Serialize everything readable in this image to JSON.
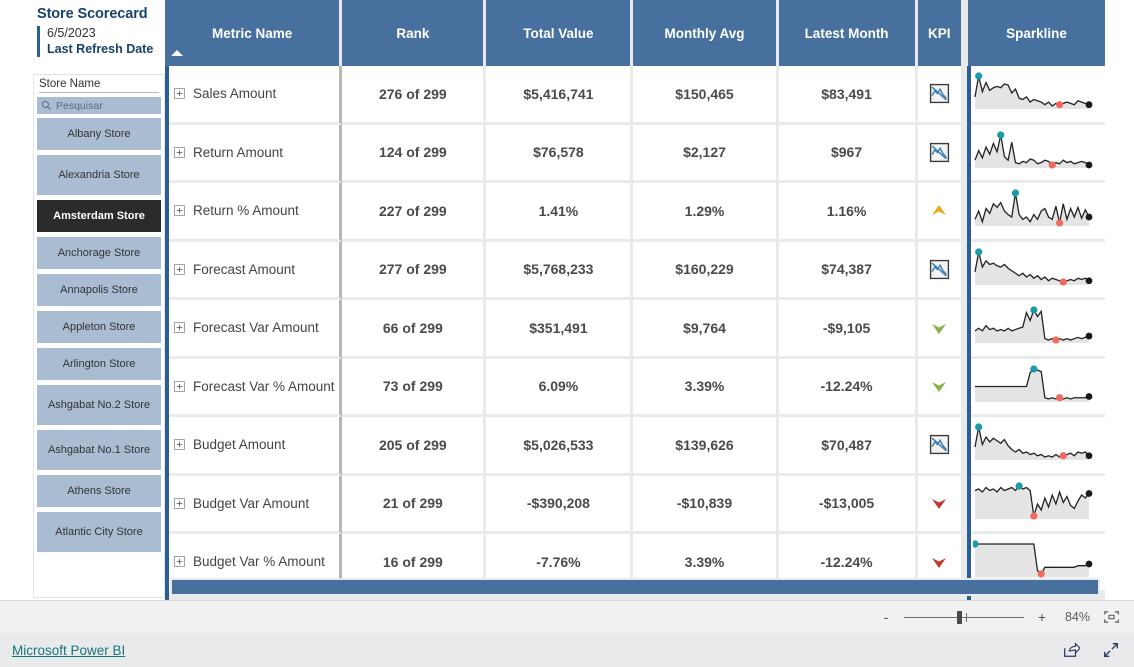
{
  "scorecard": {
    "title": "Store Scorecard",
    "refresh_date": "6/5/2023",
    "refresh_label": "Last Refresh Date"
  },
  "slicer": {
    "title": "Store Name",
    "search_placeholder": "Pesquisar",
    "search_icon": "search-icon",
    "chevron_icon": "chevron-right-icon",
    "stores": [
      {
        "label": "Albany Store",
        "selected": false
      },
      {
        "label": "Alexandria Store",
        "selected": false
      },
      {
        "label": "Amsterdam Store",
        "selected": true
      },
      {
        "label": "Anchorage Store",
        "selected": false
      },
      {
        "label": "Annapolis Store",
        "selected": false
      },
      {
        "label": "Appleton Store",
        "selected": false
      },
      {
        "label": "Arlington Store",
        "selected": false
      },
      {
        "label": "Ashgabat No.2 Store",
        "selected": false
      },
      {
        "label": "Ashgabat No.1 Store",
        "selected": false
      },
      {
        "label": "Athens Store",
        "selected": false
      },
      {
        "label": "Atlantic City Store",
        "selected": false
      }
    ]
  },
  "table": {
    "sort_column": "Metric Name",
    "sort_direction": "ascending",
    "columns": [
      "Metric Name",
      "Rank",
      "Total Value",
      "Monthly Avg",
      "Latest Month",
      "KPI",
      "Sparkline"
    ],
    "rows": [
      {
        "metric": "Sales Amount",
        "rank": "276 of 299",
        "total_value": "$5,416,741",
        "monthly_avg": "$150,465",
        "latest_month": "$83,491",
        "total_value_color": "grey",
        "monthly_avg_color": "grey",
        "latest_month_color": "grey",
        "kpi_icon": "trend-down-chart-icon",
        "kpi_color": "#3c7fb1"
      },
      {
        "metric": "Return Amount",
        "rank": "124 of 299",
        "total_value": "$76,578",
        "monthly_avg": "$2,127",
        "latest_month": "$967",
        "total_value_color": "grey",
        "monthly_avg_color": "grey",
        "latest_month_color": "grey",
        "kpi_icon": "trend-down-chart-icon",
        "kpi_color": "#3c7fb1"
      },
      {
        "metric": "Return % Amount",
        "rank": "227 of 299",
        "total_value": "1.41%",
        "monthly_avg": "1.29%",
        "latest_month": "1.16%",
        "total_value_color": "red",
        "monthly_avg_color": "red",
        "latest_month_color": "amber",
        "kpi_icon": "arrow-up-icon",
        "kpi_color": "#eaa81e"
      },
      {
        "metric": "Forecast Amount",
        "rank": "277 of 299",
        "total_value": "$5,768,233",
        "monthly_avg": "$160,229",
        "latest_month": "$74,387",
        "total_value_color": "grey",
        "monthly_avg_color": "grey",
        "latest_month_color": "grey",
        "kpi_icon": "trend-down-chart-icon",
        "kpi_color": "#3c7fb1"
      },
      {
        "metric": "Forecast Var Amount",
        "rank": "66 of 299",
        "total_value": "$351,491",
        "monthly_avg": "$9,764",
        "latest_month": "-$9,105",
        "total_value_color": "red",
        "monthly_avg_color": "red",
        "latest_month_color": "green",
        "kpi_icon": "arrow-down-icon",
        "kpi_color": "#8bb04a"
      },
      {
        "metric": "Forecast Var % Amount",
        "rank": "73 of 299",
        "total_value": "6.09%",
        "monthly_avg": "3.39%",
        "latest_month": "-12.24%",
        "total_value_color": "red",
        "monthly_avg_color": "red",
        "latest_month_color": "green",
        "kpi_icon": "arrow-down-icon",
        "kpi_color": "#8bb04a"
      },
      {
        "metric": "Budget Amount",
        "rank": "205 of 299",
        "total_value": "$5,026,533",
        "monthly_avg": "$139,626",
        "latest_month": "$70,487",
        "total_value_color": "grey",
        "monthly_avg_color": "grey",
        "latest_month_color": "grey",
        "kpi_icon": "trend-down-chart-icon",
        "kpi_color": "#3c7fb1"
      },
      {
        "metric": "Budget Var Amount",
        "rank": "21 of 299",
        "total_value": "-$390,208",
        "monthly_avg": "-$10,839",
        "latest_month": "-$13,005",
        "total_value_color": "red",
        "monthly_avg_color": "red",
        "latest_month_color": "red",
        "kpi_icon": "arrow-down-icon",
        "kpi_color": "#c0392b"
      },
      {
        "metric": "Budget Var % Amount",
        "rank": "16 of 299",
        "total_value": "-7.76%",
        "monthly_avg": "3.39%",
        "latest_month": "-12.24%",
        "total_value_color": "red",
        "monthly_avg_color": "red",
        "latest_month_color": "red",
        "kpi_icon": "arrow-down-icon",
        "kpi_color": "#c0392b"
      }
    ]
  },
  "chart_data": {
    "type": "line",
    "title": "Sparkline trends per metric",
    "marker_colors": {
      "high": "#1a9ba8",
      "low": "#f4685e",
      "end": "#1a1a1a"
    },
    "series": [
      {
        "name": "Sales Amount",
        "values": [
          30,
          62,
          38,
          52,
          40,
          44,
          46,
          44,
          50,
          48,
          36,
          42,
          28,
          26,
          30,
          22,
          26,
          24,
          22,
          18,
          22,
          16,
          20,
          18,
          20,
          22,
          20,
          18,
          24,
          22,
          20,
          18
        ],
        "high_index": 1,
        "low_index": 23,
        "end_index": 31
      },
      {
        "name": "Return Amount",
        "values": [
          30,
          46,
          34,
          52,
          40,
          58,
          44,
          72,
          36,
          30,
          60,
          26,
          24,
          28,
          26,
          32,
          30,
          24,
          26,
          30,
          28,
          22,
          26,
          24,
          30,
          26,
          28,
          24,
          26,
          28,
          26,
          22
        ],
        "high_index": 7,
        "low_index": 21,
        "end_index": 31
      },
      {
        "name": "Return % Amount",
        "values": [
          26,
          40,
          22,
          44,
          36,
          52,
          46,
          54,
          40,
          34,
          30,
          70,
          34,
          26,
          30,
          22,
          34,
          26,
          40,
          44,
          30,
          26,
          48,
          20,
          52,
          26,
          44,
          30,
          46,
          28,
          42,
          30
        ],
        "high_index": 11,
        "low_index": 23,
        "end_index": 31
      },
      {
        "name": "Forecast Amount",
        "values": [
          32,
          64,
          40,
          50,
          44,
          46,
          42,
          40,
          44,
          38,
          34,
          30,
          26,
          30,
          24,
          28,
          22,
          26,
          20,
          24,
          18,
          22,
          20,
          18,
          16,
          18,
          20,
          18,
          22,
          20,
          22,
          18
        ],
        "high_index": 1,
        "low_index": 24,
        "end_index": 31
      },
      {
        "name": "Forecast Var Amount",
        "values": [
          30,
          34,
          30,
          38,
          32,
          34,
          30,
          32,
          30,
          34,
          30,
          32,
          34,
          36,
          58,
          46,
          62,
          52,
          60,
          18,
          16,
          18,
          16,
          18,
          16,
          18,
          16,
          18,
          20,
          18,
          20,
          22
        ],
        "high_index": 16,
        "low_index": 22,
        "end_index": 31
      },
      {
        "name": "Forecast Var % Amount",
        "values": [
          34,
          34,
          34,
          34,
          34,
          34,
          34,
          34,
          34,
          34,
          34,
          34,
          34,
          34,
          34,
          56,
          62,
          60,
          58,
          16,
          14,
          16,
          14,
          16,
          14,
          16,
          14,
          16,
          16,
          16,
          16,
          18
        ],
        "high_index": 16,
        "low_index": 23,
        "end_index": 31
      },
      {
        "name": "Budget Amount",
        "values": [
          34,
          66,
          38,
          50,
          42,
          48,
          44,
          40,
          46,
          36,
          30,
          26,
          30,
          24,
          26,
          22,
          24,
          20,
          22,
          18,
          20,
          18,
          22,
          18,
          20,
          22,
          24,
          20,
          26,
          24,
          26,
          20
        ],
        "high_index": 1,
        "low_index": 24,
        "end_index": 31
      },
      {
        "name": "Budget Var Amount",
        "values": [
          44,
          46,
          42,
          48,
          44,
          46,
          42,
          48,
          44,
          46,
          48,
          44,
          50,
          46,
          48,
          44,
          10,
          26,
          18,
          34,
          22,
          38,
          26,
          42,
          28,
          36,
          24,
          20,
          30,
          38,
          34,
          40
        ],
        "high_index": 12,
        "low_index": 16,
        "end_index": 31
      },
      {
        "name": "Budget Var % Amount",
        "values": [
          46,
          46,
          46,
          46,
          46,
          46,
          46,
          46,
          46,
          46,
          46,
          46,
          46,
          46,
          46,
          46,
          46,
          14,
          10,
          18,
          18,
          18,
          18,
          18,
          18,
          18,
          18,
          18,
          20,
          20,
          20,
          22
        ],
        "high_index": 0,
        "low_index": 18,
        "end_index": 31
      }
    ]
  },
  "bottom_bar": {
    "zoom_minus": "-",
    "zoom_plus": "+",
    "zoom_level": "84%",
    "fit_icon": "fit-to-screen-icon"
  },
  "footer": {
    "brand_link": "Microsoft Power BI",
    "share_icon": "share-icon",
    "fullscreen_icon": "expand-arrows-icon"
  }
}
